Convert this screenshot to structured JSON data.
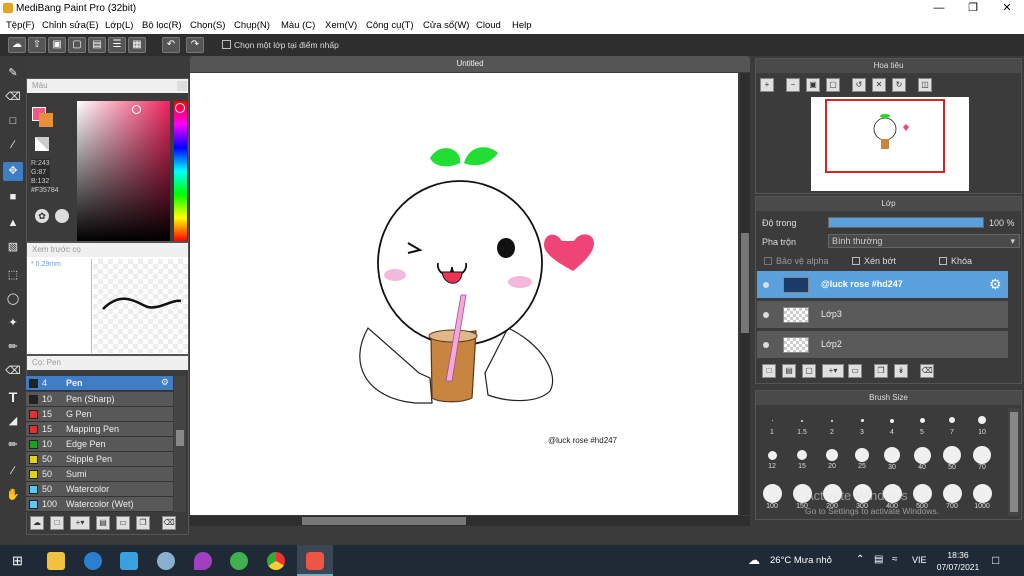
{
  "app": {
    "title": "MediBang Paint Pro (32bit)",
    "doc_title": "Untitled"
  },
  "menu": [
    "Tệp(F)",
    "Chỉnh sửa(E)",
    "Lớp(L)",
    "Bộ lọc(R)",
    "Chọn(S)",
    "Chụp(N)",
    "Màu (C)",
    "Xem(V)",
    "Công cụ(T)",
    "Cửa sổ(W)",
    "Cloud",
    "Help"
  ],
  "toolbar": {
    "checkbox_label": "Chọn một lớp tại điểm nhấp"
  },
  "color_panel": {
    "title": "Màu",
    "r": "R:243",
    "g": "G:87",
    "b": "B:132",
    "hex": "#F35784",
    "main_color": "#f35784",
    "sub_color": "#e6903a"
  },
  "preview_panel": {
    "title": "Xem trước cọ",
    "size": "0.29mm"
  },
  "brush_panel": {
    "title": "Cọ: Pen",
    "items": [
      {
        "size": "4",
        "name": "Pen",
        "color": "#222222",
        "selected": true
      },
      {
        "size": "10",
        "name": "Pen (Sharp)",
        "color": "#222222"
      },
      {
        "size": "15",
        "name": "G Pen",
        "color": "#e03030"
      },
      {
        "size": "15",
        "name": "Mapping Pen",
        "color": "#e03030"
      },
      {
        "size": "10",
        "name": "Edge Pen",
        "color": "#20a020"
      },
      {
        "size": "50",
        "name": "Stipple Pen",
        "color": "#e0d020"
      },
      {
        "size": "50",
        "name": "Sumi",
        "color": "#e0d020"
      },
      {
        "size": "50",
        "name": "Watercolor",
        "color": "#60c8f0"
      },
      {
        "size": "100",
        "name": "Watercolor (Wet)",
        "color": "#60c8f0"
      }
    ]
  },
  "navigator": {
    "title": "Hoa tiêu"
  },
  "layer_panel": {
    "title": "Lớp",
    "opacity_label": "Độ trong",
    "opacity_value": "100 %",
    "opacity": 1.0,
    "blend_label": "Pha trộn",
    "blend_value": "Bình thường",
    "protect_alpha": "Bảo vệ alpha",
    "clipping": "Xén bớt",
    "lock": "Khóa",
    "layers": [
      {
        "name": "@luck rose #hd247",
        "selected": true
      },
      {
        "name": "Lớp3"
      },
      {
        "name": "Lớp2"
      }
    ]
  },
  "brush_size": {
    "title": "Brush Size",
    "row1": [
      "1",
      "1.5",
      "2",
      "3",
      "4",
      "5",
      "7",
      "10"
    ],
    "row2": [
      "12",
      "15",
      "20",
      "25",
      "30",
      "40",
      "50",
      "70"
    ],
    "row3": [
      "100",
      "150",
      "200",
      "300",
      "400",
      "500",
      "700",
      "1000"
    ]
  },
  "canvas": {
    "signature": "@luck rose #hd247"
  },
  "watermark": {
    "line1": "Activate Windows",
    "line2": "Go to Settings to activate Windows."
  },
  "taskbar": {
    "weather": "26°C  Mưa nhỏ",
    "lang": "VIE",
    "time": "18:36",
    "date": "07/07/2021"
  }
}
